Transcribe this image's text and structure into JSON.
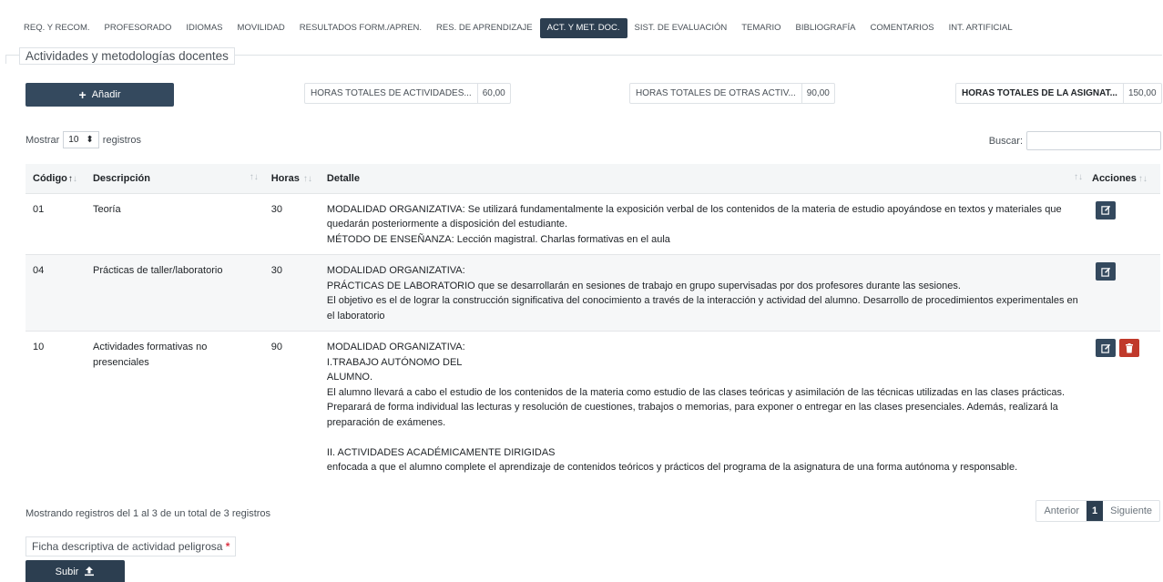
{
  "tabs": [
    {
      "label": "REQ. Y RECOM."
    },
    {
      "label": "PROFESORADO"
    },
    {
      "label": "IDIOMAS"
    },
    {
      "label": "MOVILIDAD"
    },
    {
      "label": "RESULTADOS FORM./APREN."
    },
    {
      "label": "RES. DE APRENDIZAJE"
    },
    {
      "label": "ACT. Y MET. DOC.",
      "active": true
    },
    {
      "label": "SIST. DE EVALUACIÓN"
    },
    {
      "label": "TEMARIO"
    },
    {
      "label": "BIBLIOGRAFÍA"
    },
    {
      "label": "COMENTARIOS"
    },
    {
      "label": "INT. ARTIFICIAL"
    }
  ],
  "section_title": "Actividades y metodologías docentes",
  "add_button": "Añadir",
  "totals": {
    "activities_label": "HORAS TOTALES DE ACTIVIDADES...",
    "activities_value": "60,00",
    "other_label": "HORAS TOTALES DE OTRAS ACTIV...",
    "other_value": "90,00",
    "subject_label": "HORAS TOTALES DE LA ASIGNAT...",
    "subject_value": "150,00"
  },
  "length": {
    "prefix": "Mostrar",
    "value": "10",
    "suffix": "registros"
  },
  "search_label": "Buscar:",
  "columns": {
    "code": "Código",
    "description": "Descripción",
    "hours": "Horas",
    "detail": "Detalle",
    "actions": "Acciones"
  },
  "rows": [
    {
      "code": "01",
      "description": "Teoría",
      "hours": "30",
      "detail": [
        "MODALIDAD ORGANIZATIVA: Se utilizará fundamentalmente la exposición verbal de los contenidos de la materia de estudio apoyándose en textos y materiales que quedarán posteriormente a disposición del estudiante.",
        "MÉTODO DE ENSEÑANZA: Lección magistral. Charlas formativas en el aula"
      ]
    },
    {
      "code": "04",
      "description": "Prácticas de taller/laboratorio",
      "hours": "30",
      "detail": [
        "MODALIDAD ORGANIZATIVA:",
        "PRÁCTICAS DE LABORATORIO que se desarrollarán en sesiones de trabajo en grupo supervisadas por dos profesores durante las sesiones.",
        "El objetivo es el de lograr la construcción significativa del conocimiento a través de la interacción y actividad del alumno. Desarrollo de procedimientos experimentales en el laboratorio"
      ]
    },
    {
      "code": "10",
      "description": "Actividades formativas no presenciales",
      "hours": "90",
      "detail": [
        "MODALIDAD ORGANIZATIVA:",
        "I.TRABAJO AUTÓNOMO DEL",
        "ALUMNO.",
        "El alumno llevará a cabo el estudio de los contenidos de la materia como estudio de las clases teóricas y asimilación de las técnicas utilizadas en las clases prácticas.",
        "Preparará de forma individual las lecturas y resolución de cuestiones, trabajos o memorias, para exponer o entregar en las clases presenciales. Además, realizará la preparación de exámenes.",
        "",
        "II. ACTIVIDADES ACADÉMICAMENTE DIRIGIDAS",
        "enfocada a que el alumno complete el aprendizaje de contenidos teóricos y prácticos del programa de la asignatura de una forma autónoma y responsable."
      ]
    }
  ],
  "info_text": "Mostrando registros del 1 al 3 de un total de 3 registros",
  "pager": {
    "prev": "Anterior",
    "current": "1",
    "next": "Siguiente"
  },
  "ficha_label": "Ficha descriptiva de actividad peligrosa",
  "ficha_required": "*",
  "upload_button": "Subir",
  "icons": {
    "add": "plus-icon",
    "sort": "sort-icon",
    "edit": "edit-icon",
    "delete": "trash-icon",
    "upload": "upload-icon",
    "select": "select-arrows-icon"
  },
  "colors": {
    "primary": "#2c3e50",
    "danger": "#c0392b",
    "required": "#dc3545"
  }
}
